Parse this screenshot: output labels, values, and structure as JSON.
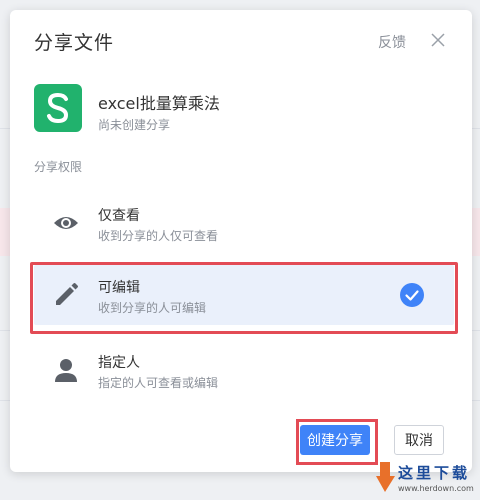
{
  "dialog": {
    "title": "分享文件",
    "feedback_label": "反馈"
  },
  "file": {
    "name": "excel批量算乘法",
    "status": "尚未创建分享",
    "icon_letter": "S",
    "icon_color": "#21b26d"
  },
  "permissions": {
    "section_label": "分享权限",
    "items": [
      {
        "icon": "eye-icon",
        "title": "仅查看",
        "desc": "收到分享的人仅可查看",
        "selected": false
      },
      {
        "icon": "pencil-icon",
        "title": "可编辑",
        "desc": "收到分享的人可编辑",
        "selected": true
      },
      {
        "icon": "person-icon",
        "title": "指定人",
        "desc": "指定的人可查看或编辑",
        "selected": false
      }
    ]
  },
  "buttons": {
    "create_label": "创建分享",
    "cancel_label": "取消"
  },
  "colors": {
    "accent": "#3f83f8",
    "highlight": "#e34b55",
    "selected_bg": "#eaf0fb"
  },
  "watermark": {
    "text": "这里下载",
    "url": "www.herdown.com"
  }
}
